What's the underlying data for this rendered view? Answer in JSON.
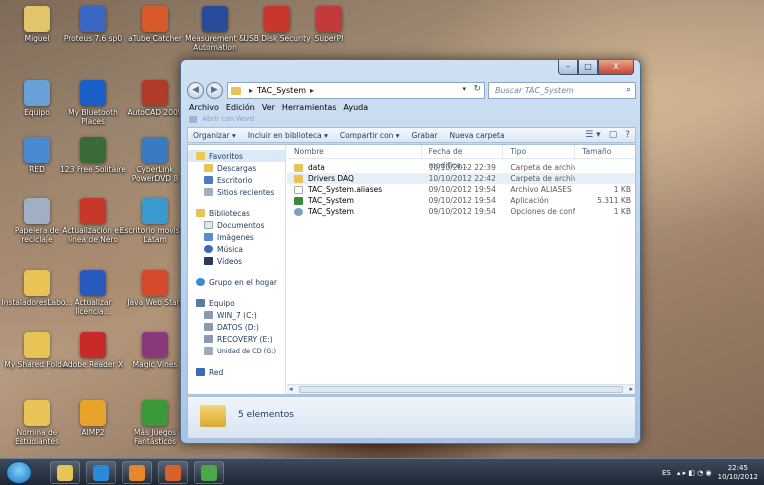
{
  "desktop_icons": [
    {
      "label": "Miguel",
      "color": "#e2c46a"
    },
    {
      "label": "Proteus 7.6 sp0",
      "color": "#3a67c4"
    },
    {
      "label": "aTube Catcher",
      "color": "#d85a2b"
    },
    {
      "label": "Measurement & Automation",
      "color": "#2a4a9a"
    },
    {
      "label": "USB Disk Security",
      "color": "#c8372b"
    },
    {
      "label": "SuperPI",
      "color": "#c33a3a"
    },
    {
      "label": "Equipo",
      "color": "#6aa0d8"
    },
    {
      "label": "My Bluetooth Places",
      "color": "#1a5fc8"
    },
    {
      "label": "AutoCAD 2009",
      "color": "#b23a2a"
    },
    {
      "label": "RED",
      "color": "#4a8ad0"
    },
    {
      "label": "123 Free Solitaire",
      "color": "#3a6a3a"
    },
    {
      "label": "CyberLink PowerDVD 8",
      "color": "#3a7ac0"
    },
    {
      "label": "Papelera de reciclaje",
      "color": "#9fb0c4"
    },
    {
      "label": "Actualización en línea de Nero",
      "color": "#c8372b"
    },
    {
      "label": "Escritorio movistar Latam",
      "color": "#3a9ad0"
    },
    {
      "label": "InstaladoresLabo...",
      "color": "#e8c456"
    },
    {
      "label": "Actualizar licencia...",
      "color": "#2a5ac0"
    },
    {
      "label": "Java Web Start",
      "color": "#d44a2a"
    },
    {
      "label": "My Shared Folder",
      "color": "#e8c456"
    },
    {
      "label": "Adobe Reader X",
      "color": "#c82a2a"
    },
    {
      "label": "Magic Vines",
      "color": "#8a3a7a"
    },
    {
      "label": "Nomina de Estudiantes",
      "color": "#e8c456"
    },
    {
      "label": "AIMP2",
      "color": "#e8a42a"
    },
    {
      "label": "Más Juegos Fantásticos",
      "color": "#3a9a3a"
    }
  ],
  "explorer": {
    "caption": {
      "minimize": "–",
      "maximize": "□",
      "close": "X"
    },
    "nav": {
      "back": "◀",
      "forward": "▶"
    },
    "address": {
      "root_sep": "▸",
      "folder": "TAC_System",
      "trail_sep": "▸",
      "dropdown": "▾",
      "refresh": "↻"
    },
    "search": {
      "placeholder": "Buscar TAC_System",
      "icon": "⌕"
    },
    "menu": [
      "Archivo",
      "Edición",
      "Ver",
      "Herramientas",
      "Ayuda"
    ],
    "open_with": "Abrir con Word",
    "toolbar": {
      "organize": "Organizar ▾",
      "include": "Incluir en biblioteca ▾",
      "share": "Compartir con ▾",
      "burn": "Grabar",
      "new_folder": "Nueva carpeta",
      "view_icon": "☰ ▾",
      "pane_icon": "▢",
      "help_icon": "?"
    },
    "nav_pane": {
      "favorites": {
        "label": "Favoritos",
        "items": [
          "Descargas",
          "Escritorio",
          "Sitios recientes"
        ]
      },
      "libraries": {
        "label": "Bibliotecas",
        "items": [
          "Documentos",
          "Imágenes",
          "Música",
          "Vídeos"
        ]
      },
      "homegroup": "Grupo en el hogar",
      "computer": {
        "label": "Equipo",
        "items": [
          "WIN_7 (C:)",
          "DATOS (D:)",
          "RECOVERY (E:)",
          "Unidad de CD (G:)"
        ]
      },
      "network": "Red"
    },
    "columns": {
      "name": "Nombre",
      "date": "Fecha de modifica...",
      "type": "Tipo",
      "size": "Tamaño"
    },
    "files": [
      {
        "name": "data",
        "date": "10/10/2012 22:39",
        "type": "Carpeta de archivos",
        "size": "",
        "kind": "folder"
      },
      {
        "name": "Drivers DAQ",
        "date": "10/10/2012 22:42",
        "type": "Carpeta de archivos",
        "size": "",
        "kind": "folder"
      },
      {
        "name": "TAC_System.aliases",
        "date": "09/10/2012 19:54",
        "type": "Archivo ALIASES",
        "size": "1 KB",
        "kind": "doc"
      },
      {
        "name": "TAC_System",
        "date": "09/10/2012 19:54",
        "type": "Aplicación",
        "size": "5.311 KB",
        "kind": "app"
      },
      {
        "name": "TAC_System",
        "date": "09/10/2012 19:54",
        "type": "Opciones de confi...",
        "size": "1 KB",
        "kind": "cfg"
      }
    ],
    "status": {
      "item_count": "5 elementos"
    }
  },
  "taskbar": {
    "tray": {
      "lang": "ES",
      "icons": "▴ ▸ ◧ ◔ ◉",
      "time": "22:45",
      "date": "10/10/2012"
    },
    "pinned": [
      {
        "name": "explorer",
        "color": "#e8c456"
      },
      {
        "name": "ie",
        "color": "#2a8ad8"
      },
      {
        "name": "media",
        "color": "#e8862a"
      },
      {
        "name": "firefox",
        "color": "#d8622a"
      },
      {
        "name": "misc",
        "color": "#4aa84a"
      }
    ]
  }
}
